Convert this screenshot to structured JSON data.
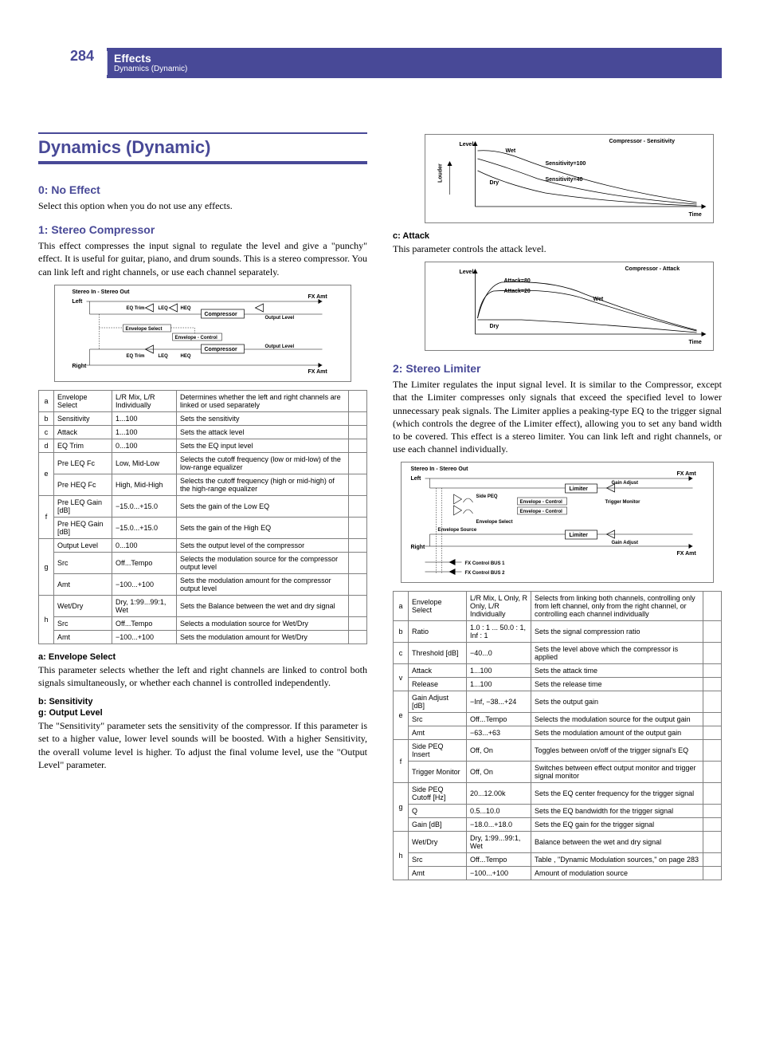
{
  "header": {
    "page_num": "284",
    "title": "Effects",
    "subtitle": "Dynamics (Dynamic)"
  },
  "left": {
    "section_title": "Dynamics (Dynamic)",
    "s0_title": "0: No Effect",
    "s0_body": "Select this option when you do not use any effects.",
    "s1_title": "1: Stereo Compressor",
    "s1_body": "This effect compresses the input signal to regulate the level and give a \"punchy\" effect. It is useful for guitar, piano, and drum sounds. This is a stereo compressor. You can link left and right channels, or use each channel separately.",
    "diag1": {
      "title": "Stereo In - Stereo Out",
      "left": "Left",
      "right": "Right",
      "eq_trim": "EQ Trim",
      "leq": "LEQ",
      "heq": "HEQ",
      "compressor": "Compressor",
      "output_level": "Output Level",
      "fx_amt": "FX Amt",
      "env_sel": "Envelope Select",
      "env_ctrl": "Envelope - Control"
    },
    "table1": [
      {
        "idx": "a",
        "name": "Envelope Select",
        "range": "L/R Mix, L/R Individually",
        "desc": "Determines whether the left and right channels are linked or used separately"
      },
      {
        "idx": "b",
        "name": "Sensitivity",
        "range": "1...100",
        "desc": "Sets the sensitivity"
      },
      {
        "idx": "c",
        "name": "Attack",
        "range": "1...100",
        "desc": "Sets the attack level"
      },
      {
        "idx": "d",
        "name": "EQ Trim",
        "range": "0...100",
        "desc": "Sets the EQ input level"
      },
      {
        "idx": "e",
        "rows": [
          {
            "name": "Pre LEQ Fc",
            "range": "Low, Mid-Low",
            "desc": "Selects the cutoff frequency (low or mid-low) of the low-range equalizer"
          },
          {
            "name": "Pre HEQ Fc",
            "range": "High, Mid-High",
            "desc": "Selects the cutoff frequency (high or mid-high) of the high-range equalizer"
          }
        ]
      },
      {
        "idx": "f",
        "rows": [
          {
            "name": "Pre LEQ Gain [dB]",
            "range": "−15.0...+15.0",
            "desc": "Sets the gain of the Low EQ"
          },
          {
            "name": "Pre HEQ Gain [dB]",
            "range": "−15.0...+15.0",
            "desc": "Sets the gain of the High EQ"
          }
        ]
      },
      {
        "idx": "g",
        "rows": [
          {
            "name": "Output Level",
            "range": "0...100",
            "desc": "Sets the output level of the compressor"
          },
          {
            "name": "Src",
            "range": "Off...Tempo",
            "desc": "Selects the modulation source for the compressor output level"
          },
          {
            "name": "Amt",
            "range": "−100...+100",
            "desc": "Sets the modulation amount for the compressor output level"
          }
        ]
      },
      {
        "idx": "h",
        "rows": [
          {
            "name": "Wet/Dry",
            "range": "Dry, 1:99...99:1, Wet",
            "desc": "Sets the Balance between the wet and dry signal"
          },
          {
            "name": "Src",
            "range": "Off...Tempo",
            "desc": "Selects a modulation source for Wet/Dry"
          },
          {
            "name": "Amt",
            "range": "−100...+100",
            "desc": "Sets the modulation amount for Wet/Dry"
          }
        ]
      }
    ],
    "a_label": "a: Envelope Select",
    "a_body": "This parameter selects whether the left and right channels are linked to control both signals simultaneously, or whether each channel is controlled independently.",
    "b_label": "b: Sensitivity",
    "g_label": "g: Output Level",
    "bg_body": "The \"Sensitivity\" parameter sets the sensitivity of the compressor. If this parameter is set to a higher value, lower level sounds will be boosted. With a higher Sensitivity, the overall volume level is higher. To adjust the final volume level, use the \"Output Level\" parameter."
  },
  "right": {
    "graph1": {
      "title": "Compressor - Sensitivity",
      "level": "Level",
      "louder": "Louder",
      "wet": "Wet",
      "dry": "Dry",
      "s100": "Sensitivity=100",
      "s40": "Sensitivity=40",
      "time": "Time"
    },
    "c_label": "c: Attack",
    "c_body": "This parameter controls the attack level.",
    "graph2": {
      "title": "Compressor - Attack",
      "level": "Level",
      "a80": "Attack=80",
      "a20": "Attack=20",
      "wet": "Wet",
      "dry": "Dry",
      "time": "Time"
    },
    "s2_title": "2: Stereo Limiter",
    "s2_body": "The Limiter regulates the input signal level. It is similar to the Compressor, except that the Limiter compresses only signals that exceed the specified level to lower unnecessary peak signals. The Limiter applies a peaking-type EQ to the trigger signal (which controls the degree of the Limiter effect), allowing you to set any band width to be covered. This effect is a stereo limiter. You can link left and right channels, or use each channel individually.",
    "diag2": {
      "title": "Stereo In - Stereo Out",
      "left": "Left",
      "right": "Right",
      "side_peq": "Side PEQ",
      "env_ctrl": "Envelope - Control",
      "limiter": "Limiter",
      "gain_adj": "Gain Adjust",
      "fx_amt": "FX Amt",
      "trigger": "Trigger Monitor",
      "env_sel": "Envelope Select",
      "env_src": "Envelope Source",
      "bus1": "FX Control BUS 1",
      "bus2": "FX Control BUS 2"
    },
    "table2": [
      {
        "idx": "a",
        "name": "Envelope Select",
        "range": "L/R Mix, L Only, R Only, L/R Individually",
        "desc": "Selects from linking both channels, controlling only from left channel, only from the right channel, or controlling each channel individually"
      },
      {
        "idx": "b",
        "name": "Ratio",
        "range": "1.0 : 1 ... 50.0 : 1, Inf : 1",
        "desc": "Sets the signal compression ratio"
      },
      {
        "idx": "c",
        "name": "Threshold [dB]",
        "range": "−40...0",
        "desc": "Sets the level above which the compressor is applied"
      },
      {
        "idx": "v",
        "rows": [
          {
            "name": "Attack",
            "range": "1...100",
            "desc": "Sets the attack time"
          },
          {
            "name": "Release",
            "range": "1...100",
            "desc": "Sets the release time"
          }
        ]
      },
      {
        "idx": "e",
        "rows": [
          {
            "name": "Gain Adjust [dB]",
            "range": "−Inf, −38...+24",
            "desc": "Sets the output gain"
          },
          {
            "name": "Src",
            "range": "Off...Tempo",
            "desc": "Selects the modulation source for the output gain"
          },
          {
            "name": "Amt",
            "range": "−63...+63",
            "desc": "Sets the modulation amount of the output gain"
          }
        ]
      },
      {
        "idx": "f",
        "rows": [
          {
            "name": "Side PEQ Insert",
            "range": "Off, On",
            "desc": "Toggles between on/off of the trigger signal's EQ"
          },
          {
            "name": "Trigger Monitor",
            "range": "Off, On",
            "desc": "Switches between effect output monitor and trigger signal monitor"
          }
        ]
      },
      {
        "idx": "g",
        "rows": [
          {
            "name": "Side PEQ Cutoff [Hz]",
            "range": "20...12.00k",
            "desc": "Sets the EQ center frequency for the trigger signal"
          },
          {
            "name": "Q",
            "range": "0.5...10.0",
            "desc": "Sets the EQ bandwidth for the trigger signal"
          },
          {
            "name": "Gain [dB]",
            "range": "−18.0...+18.0",
            "desc": "Sets the EQ gain for the trigger signal"
          }
        ]
      },
      {
        "idx": "h",
        "rows": [
          {
            "name": "Wet/Dry",
            "range": "Dry, 1:99...99:1, Wet",
            "desc": "Balance between the wet and dry signal"
          },
          {
            "name": "Src",
            "range": "Off...Tempo",
            "desc": "Table , \"Dynamic Modulation sources,\" on page 283"
          },
          {
            "name": "Amt",
            "range": "−100...+100",
            "desc": "Amount of modulation source"
          }
        ]
      }
    ]
  },
  "chart_data": [
    {
      "type": "line",
      "title": "Compressor - Sensitivity",
      "xlabel": "Time",
      "ylabel": "Level / Louder",
      "series": [
        {
          "name": "Wet (Sensitivity=100)",
          "note": "upper decay curve"
        },
        {
          "name": "Wet (Sensitivity=40)",
          "note": "middle decay curve"
        },
        {
          "name": "Dry",
          "note": "lower decay curve"
        }
      ]
    },
    {
      "type": "line",
      "title": "Compressor - Attack",
      "xlabel": "Time",
      "ylabel": "Level",
      "series": [
        {
          "name": "Attack=80",
          "note": "slower rise curve"
        },
        {
          "name": "Attack=20",
          "note": "faster rise curve"
        },
        {
          "name": "Wet",
          "note": "upper envelope"
        },
        {
          "name": "Dry",
          "note": "lower steady line"
        }
      ]
    }
  ]
}
